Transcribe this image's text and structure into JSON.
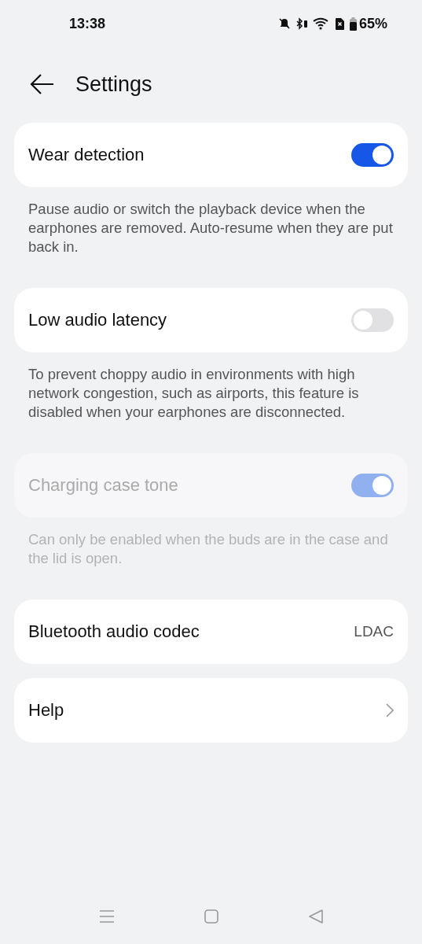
{
  "status_bar": {
    "time": "13:38",
    "battery": "65%"
  },
  "header": {
    "title": "Settings"
  },
  "items": [
    {
      "kind": "toggle",
      "label": "Wear detection",
      "on": true,
      "disabled": false,
      "description": "Pause audio or switch the playback device when the earphones are removed. Auto-resume when they are put back in."
    },
    {
      "kind": "toggle",
      "label": "Low audio latency",
      "on": false,
      "disabled": false,
      "description": "To prevent choppy audio in environments with high network congestion, such as airports, this feature is disabled when your earphones are disconnected."
    },
    {
      "kind": "toggle",
      "label": "Charging case tone",
      "on": true,
      "disabled": true,
      "description": "Can only be enabled when the buds are in the case and the lid is open."
    },
    {
      "kind": "value",
      "label": "Bluetooth audio codec",
      "value": "LDAC"
    },
    {
      "kind": "link",
      "label": "Help"
    }
  ]
}
